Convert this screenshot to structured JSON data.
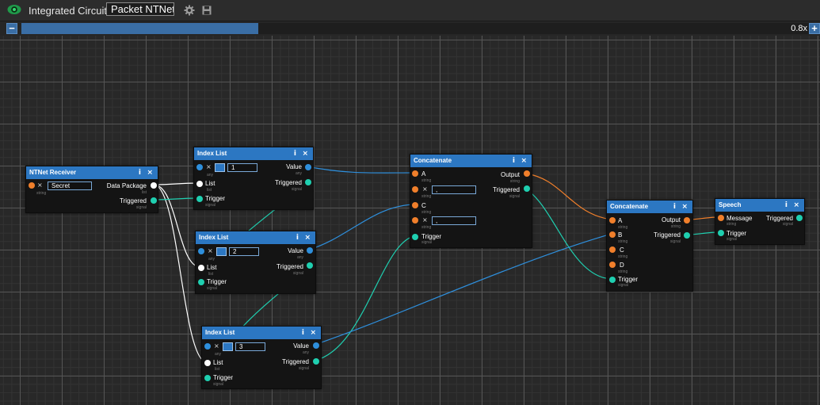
{
  "window": {
    "title": "Integrated Circuit",
    "circuit_name": "Packet NTNet",
    "zoom": {
      "label": "0.8x",
      "level": 0.3
    },
    "icons": [
      "eye-icon",
      "gear-icon",
      "save-icon",
      "zoom-out-icon",
      "zoom-in-icon"
    ]
  },
  "nodes": {
    "ntnet_receiver": {
      "title": "NTNet Receiver",
      "input_value": "Secret",
      "input_type": "string",
      "out1": "Data Package",
      "out1_type": "list",
      "out2": "Triggered",
      "out2_type": "signal"
    },
    "index_list_1": {
      "title": "Index List",
      "index": "1",
      "index_type": "any",
      "list": "List",
      "list_type": "list",
      "trigger": "Trigger",
      "trigger_type": "signal",
      "value": "Value",
      "value_type": "any",
      "triggered": "Triggered",
      "triggered_type": "signal"
    },
    "index_list_2": {
      "title": "Index List",
      "index": "2",
      "index_type": "any",
      "list": "List",
      "list_type": "list",
      "trigger": "Trigger",
      "trigger_type": "signal",
      "value": "Value",
      "value_type": "any",
      "triggered": "Triggered",
      "triggered_type": "signal"
    },
    "index_list_3": {
      "title": "Index List",
      "index": "3",
      "index_type": "any",
      "list": "List",
      "list_type": "list",
      "trigger": "Trigger",
      "trigger_type": "signal",
      "value": "Value",
      "value_type": "any",
      "triggered": "Triggered",
      "triggered_type": "signal"
    },
    "concatenate_1": {
      "title": "Concatenate",
      "a": "A",
      "a_type": "string",
      "b_value": ",",
      "b_type": "string",
      "c": "C",
      "c_type": "string",
      "d_value": ",",
      "d_type": "string",
      "trigger": "Trigger",
      "trigger_type": "signal",
      "output": "Output",
      "output_type": "string",
      "triggered": "Triggered",
      "triggered_type": "signal"
    },
    "concatenate_2": {
      "title": "Concatenate",
      "a": "A",
      "a_type": "string",
      "b": "B",
      "b_type": "string",
      "c": "C",
      "c_type": "string",
      "d": "D",
      "d_type": "string",
      "trigger": "Trigger",
      "trigger_type": "signal",
      "output": "Output",
      "output_type": "string",
      "triggered": "Triggered",
      "triggered_type": "signal"
    },
    "speech": {
      "title": "Speech",
      "message": "Message",
      "message_type": "string",
      "trigger": "Trigger",
      "trigger_type": "signal",
      "triggered": "Triggered",
      "triggered_type": "signal"
    }
  },
  "node_buttons": {
    "info": "i",
    "close": "×",
    "remove": "×"
  },
  "colors": {
    "header": "#2c77c2",
    "pin_any": "#2e8fdc",
    "pin_string": "#f07f2b",
    "pin_list": "#ffffff",
    "pin_signal": "#1fcfb0"
  }
}
